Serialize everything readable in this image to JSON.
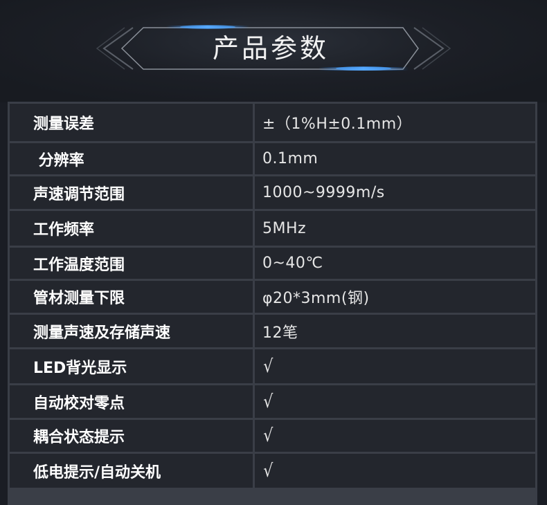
{
  "title": "产品参数",
  "rows": [
    {
      "label": "测量误差",
      "value": "±（1%H±0.1mm）"
    },
    {
      "label": " 分辨率",
      "value": "0.1mm"
    },
    {
      "label": "声速调节范围",
      "value": "1000~9999m/s"
    },
    {
      "label": "工作频率",
      "value": "5MHz"
    },
    {
      "label": "工作温度范围",
      "value": "0~40℃"
    },
    {
      "label": "管材测量下限",
      "value": "φ20*3mm(钢)"
    },
    {
      "label": "测量声速及存储声速",
      "value": "12笔"
    },
    {
      "label": "LED背光显示",
      "value": "√"
    },
    {
      "label": "自动校对零点",
      "value": "√"
    },
    {
      "label": "耦合状态提示",
      "value": "√"
    },
    {
      "label": "低电提示/自动关机",
      "value": "√"
    }
  ],
  "colors": {
    "background": "#1a1d24",
    "cell": "#23262d",
    "grid": "#3a3e47",
    "accent": "#2f8fff"
  }
}
